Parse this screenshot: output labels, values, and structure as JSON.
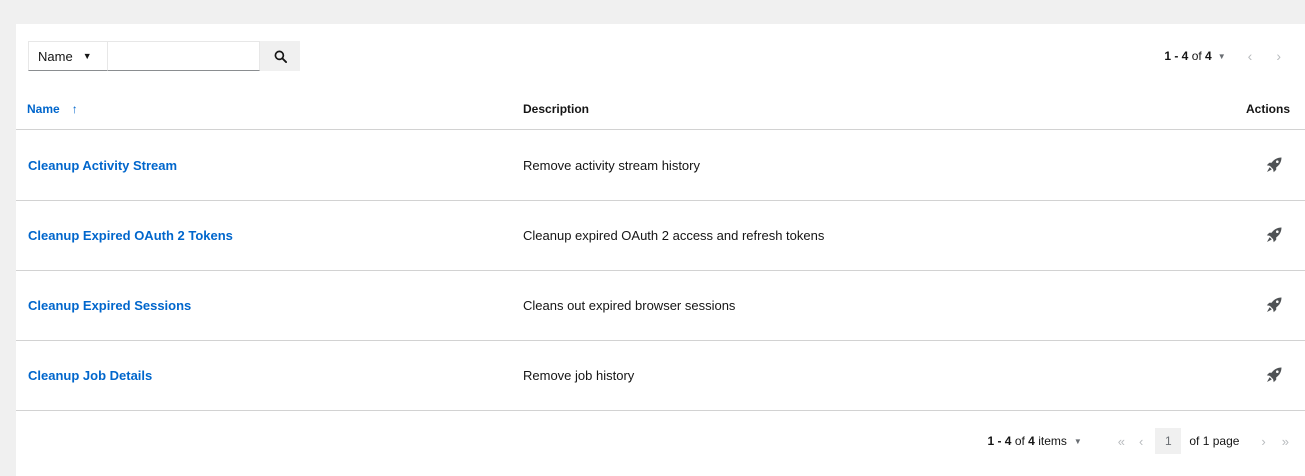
{
  "toolbar": {
    "filter_label": "Name",
    "search_placeholder": ""
  },
  "top_pager": {
    "range": "1 - 4",
    "of": "of",
    "total": "4"
  },
  "table": {
    "columns": {
      "name": "Name",
      "description": "Description",
      "actions": "Actions"
    },
    "rows": [
      {
        "name": "Cleanup Activity Stream",
        "description": "Remove activity stream history",
        "action_icon": "rocket-icon"
      },
      {
        "name": "Cleanup Expired OAuth 2 Tokens",
        "description": "Cleanup expired OAuth 2 access and refresh tokens",
        "action_icon": "rocket-icon"
      },
      {
        "name": "Cleanup Expired Sessions",
        "description": "Cleans out expired browser sessions",
        "action_icon": "rocket-icon"
      },
      {
        "name": "Cleanup Job Details",
        "description": "Remove job history",
        "action_icon": "rocket-icon"
      }
    ]
  },
  "footer_pager": {
    "range": "1 - 4",
    "of": "of",
    "total": "4",
    "items_label": "items",
    "page": "1",
    "of_pages": "of 1 page"
  },
  "colors": {
    "link": "#0066cc",
    "background": "#f0f0f0",
    "border": "#d2d2d2"
  }
}
